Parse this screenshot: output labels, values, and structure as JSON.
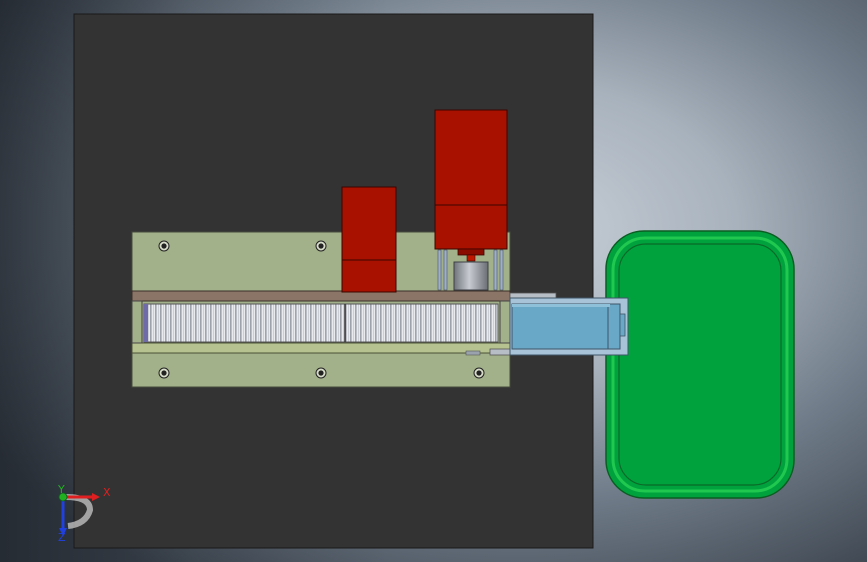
{
  "viewport": {
    "background_colors": [
      "#c9d0d8",
      "#6f7b88",
      "#3c444e"
    ]
  },
  "model": {
    "base_plate_color": "#333333",
    "mount_plate_color": "#a3b18a",
    "motor_color": "#a81000",
    "slide_color": "#6aa8c8",
    "tray_color": "#00a23e",
    "tray_border_color": "#14c24c"
  },
  "triad": {
    "x_label": "X",
    "y_label": "Y",
    "z_label": "Z",
    "x_color": "#e02020",
    "y_color": "#20b020",
    "z_color": "#2040e0"
  }
}
